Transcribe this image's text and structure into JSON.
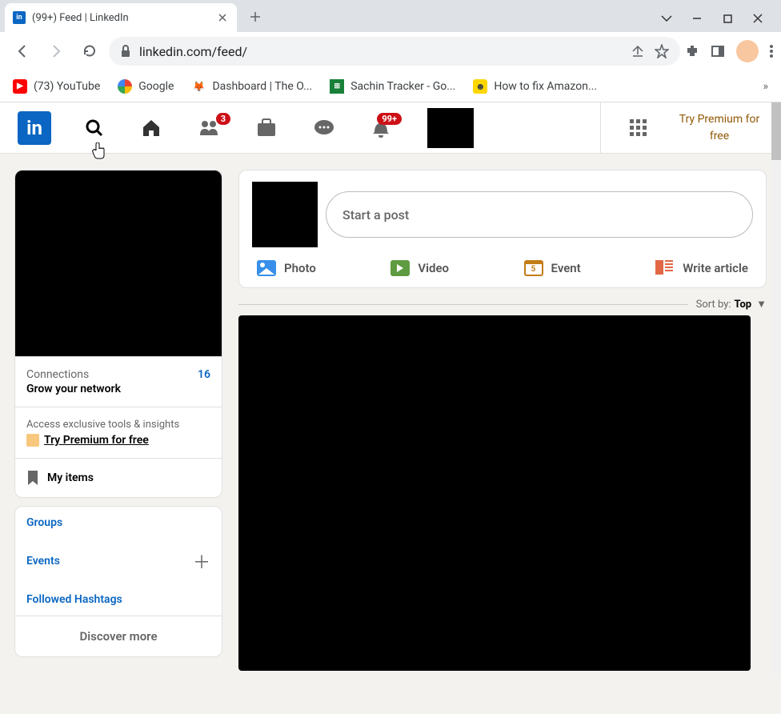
{
  "browser": {
    "tab_title": "(99+) Feed | LinkedIn",
    "url": "linkedin.com/feed/"
  },
  "bookmarks": {
    "youtube": "(73) YouTube",
    "google": "Google",
    "dashboard": "Dashboard | The O...",
    "tracker": "Sachin Tracker - Go...",
    "amazon": "How to fix Amazon..."
  },
  "header": {
    "logo_text": "in",
    "network_badge": "3",
    "notif_badge": "99+",
    "try_premium": "Try Premium for free"
  },
  "profile_card": {
    "connections_label": "Connections",
    "connections_count": "16",
    "grow": "Grow your network",
    "access_tools": "Access exclusive tools & insights",
    "try_premium": "Try Premium for free",
    "my_items": "My items"
  },
  "community": {
    "groups": "Groups",
    "events": "Events",
    "hashtags": "Followed Hashtags",
    "discover": "Discover more"
  },
  "post_box": {
    "placeholder": "Start a post",
    "photo": "Photo",
    "video": "Video",
    "event": "Event",
    "article": "Write article"
  },
  "sort": {
    "label": "Sort by:",
    "value": "Top"
  }
}
